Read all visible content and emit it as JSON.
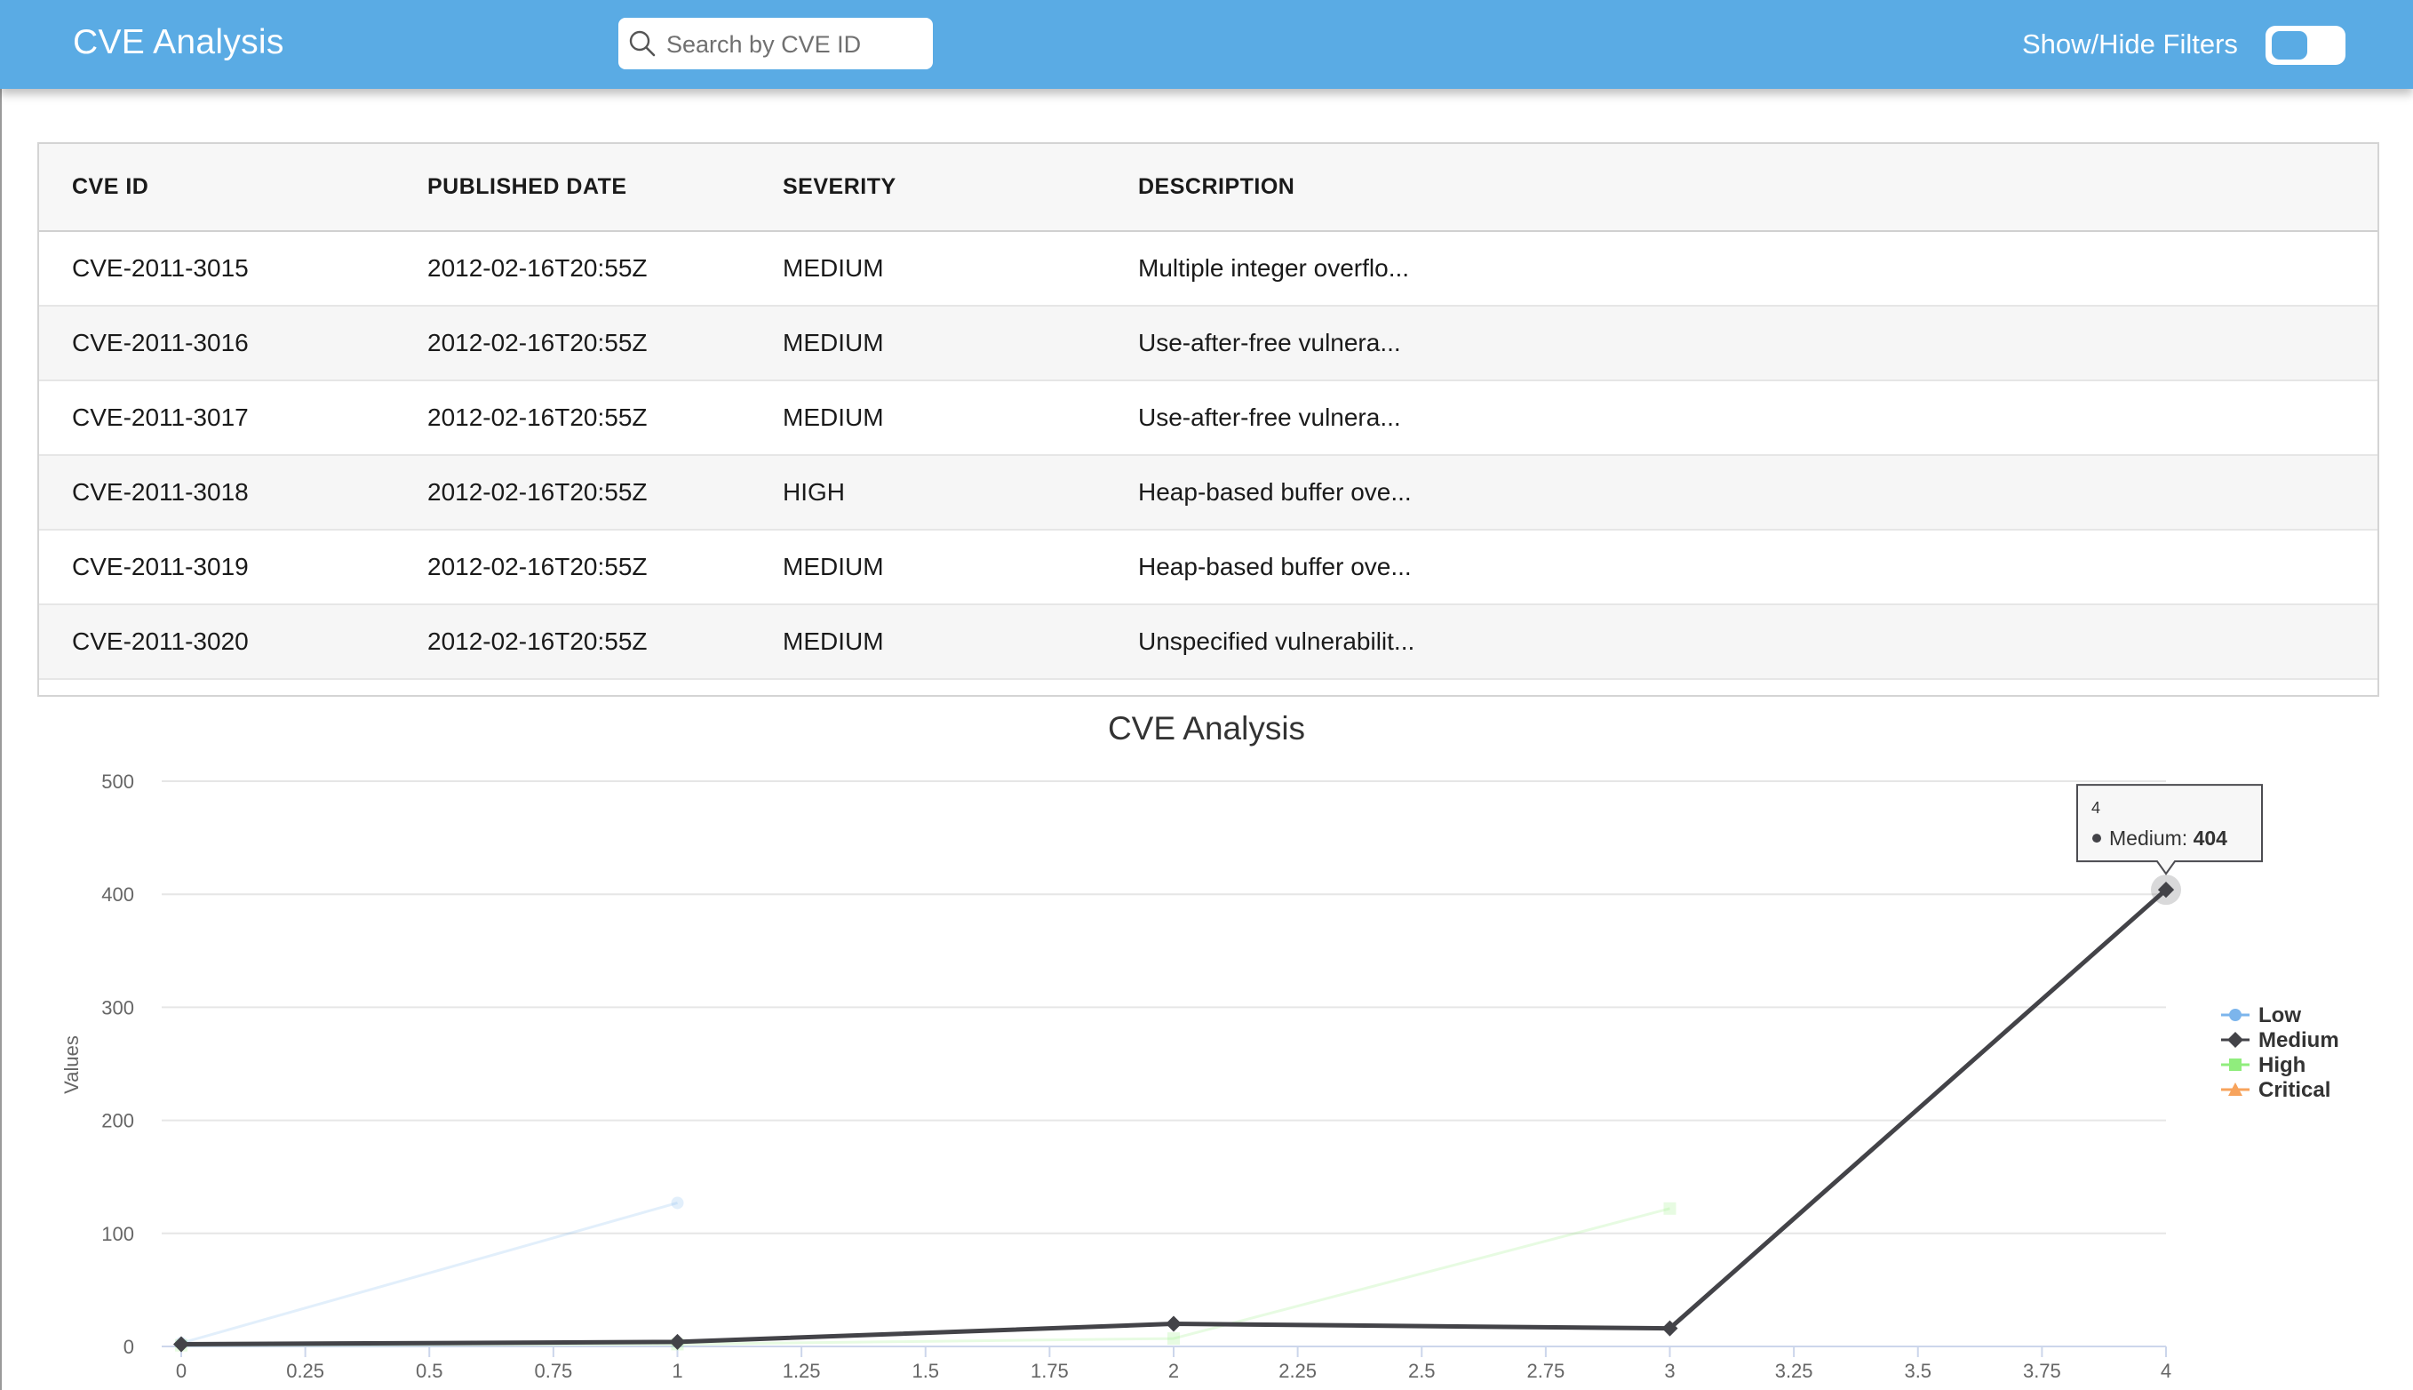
{
  "header": {
    "title": "CVE Analysis",
    "search_placeholder": "Search by CVE ID",
    "filters_label": "Show/Hide Filters"
  },
  "table": {
    "columns": [
      "CVE ID",
      "PUBLISHED DATE",
      "SEVERITY",
      "DESCRIPTION"
    ],
    "rows": [
      [
        "CVE-2011-3015",
        "2012-02-16T20:55Z",
        "MEDIUM",
        "Multiple integer overflo..."
      ],
      [
        "CVE-2011-3016",
        "2012-02-16T20:55Z",
        "MEDIUM",
        "Use-after-free vulnera..."
      ],
      [
        "CVE-2011-3017",
        "2012-02-16T20:55Z",
        "MEDIUM",
        "Use-after-free vulnera..."
      ],
      [
        "CVE-2011-3018",
        "2012-02-16T20:55Z",
        "HIGH",
        "Heap-based buffer ove..."
      ],
      [
        "CVE-2011-3019",
        "2012-02-16T20:55Z",
        "MEDIUM",
        "Heap-based buffer ove..."
      ],
      [
        "CVE-2011-3020",
        "2012-02-16T20:55Z",
        "MEDIUM",
        "Unspecified vulnerabilit..."
      ]
    ]
  },
  "chart_data": {
    "type": "line",
    "title": "CVE Analysis",
    "ylabel": "Values",
    "xlabel": "",
    "xlim": [
      0,
      4
    ],
    "ylim": [
      0,
      500
    ],
    "x_ticks": [
      "0",
      "0.25",
      "0.5",
      "0.75",
      "1",
      "1.25",
      "1.5",
      "1.75",
      "2",
      "2.25",
      "2.5",
      "2.75",
      "3",
      "3.25",
      "3.5",
      "3.75",
      "4"
    ],
    "y_ticks": [
      "0",
      "100",
      "200",
      "300",
      "400",
      "500"
    ],
    "grid": true,
    "legend_position": "right",
    "series": [
      {
        "name": "Low",
        "color": "#7cb5ec",
        "marker": "circle",
        "dimmed": true,
        "x": [
          0,
          1
        ],
        "y": [
          3,
          127
        ]
      },
      {
        "name": "Medium",
        "color": "#434348",
        "marker": "diamond",
        "dimmed": false,
        "x": [
          0,
          1,
          2,
          3,
          4
        ],
        "y": [
          2,
          4,
          20,
          16,
          404
        ]
      },
      {
        "name": "High",
        "color": "#90ed7d",
        "marker": "square",
        "dimmed": true,
        "x": [
          0,
          1,
          2,
          3
        ],
        "y": [
          1,
          2,
          7,
          122
        ]
      },
      {
        "name": "Critical",
        "color": "#f7a35c",
        "marker": "triangle",
        "dimmed": true,
        "x": [],
        "y": []
      }
    ],
    "tooltip": {
      "x_label": "4",
      "series": "Medium",
      "value": "404"
    }
  }
}
